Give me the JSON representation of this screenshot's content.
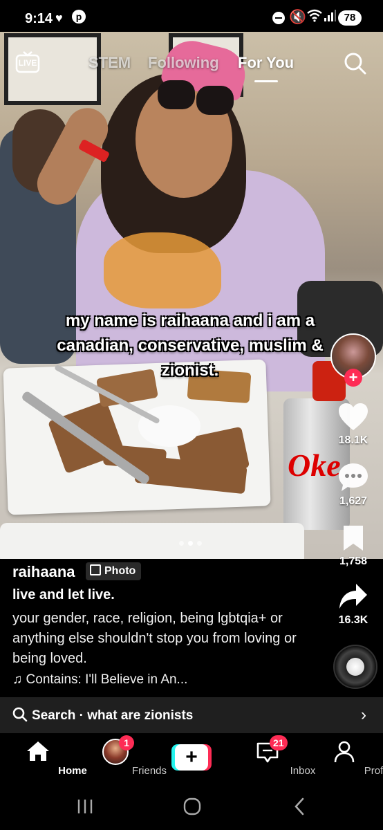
{
  "status_bar": {
    "time": "9:14",
    "battery": "78"
  },
  "top_nav": {
    "live_label": "LIVE",
    "tabs": [
      {
        "label": "STEM",
        "active": false
      },
      {
        "label": "Following",
        "active": false
      },
      {
        "label": "For You",
        "active": true
      }
    ]
  },
  "post": {
    "caption_overlay": "my name is raihaana and i am a canadian, conservative, muslim & zionist.",
    "username": "raihaana",
    "type_badge": "Photo",
    "title": "live and let live.",
    "description": "your gender, race, religion, being lgbtqia+ or anything else shouldn't stop you from loving or being loved.",
    "music": "Contains: I'll Believe in An...",
    "carousel": {
      "count": 3,
      "active": 2
    }
  },
  "actions": {
    "likes": "18.1K",
    "comments": "1,627",
    "bookmarks": "1,758",
    "shares": "16.3K"
  },
  "search_bar": {
    "text": "Search · what are zionists"
  },
  "bottom_nav": {
    "items": [
      {
        "label": "Home",
        "active": true
      },
      {
        "label": "Friends",
        "badge": "1"
      },
      {
        "label": ""
      },
      {
        "label": "Inbox",
        "badge": "21"
      },
      {
        "label": "Profile"
      }
    ]
  },
  "colors": {
    "accent": "#fe2c55",
    "cyan": "#25f4ee",
    "background": "#000000"
  }
}
